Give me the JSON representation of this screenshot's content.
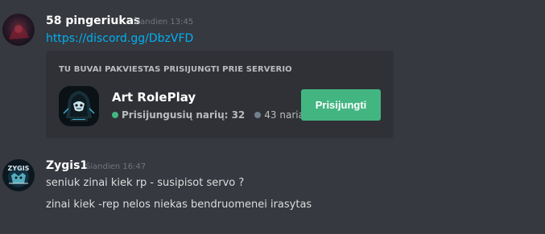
{
  "colors": {
    "background": "#36393f",
    "embed_background": "#2f3136",
    "link": "#00b0f4",
    "join_button": "#43b581",
    "online_dot": "#43b581",
    "members_dot": "#747f8d"
  },
  "messages": [
    {
      "username": "58 pingeriukas",
      "timestamp": "Šiandien 13:45",
      "avatar": "dark-red-avatar",
      "link": "https://discord.gg/DbzVFD",
      "invite": {
        "header": "TU BUVAI PAKVIESTAS PRISIJUNGTI PRIE SERVERIO",
        "server_name": "Art RolePlay",
        "server_icon": "hooded-figure-logo",
        "online_label": "Prisijungusių narių: 32",
        "members_label": "43 nariai",
        "join_label": "Prisijungti"
      }
    },
    {
      "username": "Zygis1",
      "timestamp": "Šiandien 16:47",
      "avatar": "zygis-logo-avatar",
      "lines": [
        "seniuk zinai kiek rp - susipisot servo ?",
        "zinai kiek -rep nelos niekas bendruomenei irasytas"
      ]
    }
  ]
}
